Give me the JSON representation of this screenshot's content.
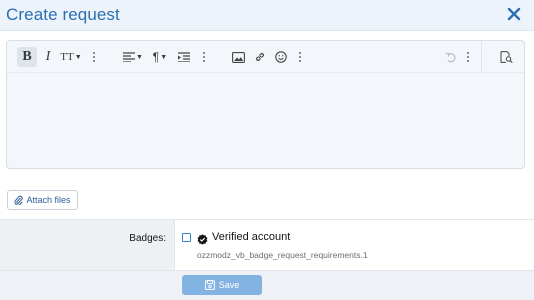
{
  "header": {
    "title": "Create request",
    "close_icon": "close-icon"
  },
  "editor": {
    "toolbar": {
      "bold": "B",
      "italic": "I",
      "font_size": "TT",
      "icons": [
        "bold-icon",
        "italic-icon",
        "font-size-icon",
        "more-icon",
        "align-icon",
        "paragraph-icon",
        "indent-icon",
        "more-icon",
        "image-icon",
        "link-icon",
        "emoji-icon",
        "more-icon",
        "undo-icon",
        "more-icon",
        "preview-icon"
      ]
    },
    "content": ""
  },
  "attach": {
    "label": "Attach files"
  },
  "form": {
    "badges_label": "Badges:",
    "badge_option": "Verified account",
    "badge_hint": "ozzmodz_vb_badge_request_requirements.1",
    "checked": false
  },
  "footer": {
    "save_label": "Save"
  },
  "colors": {
    "accent": "#2c6fb2",
    "save_bg": "#82b3e3",
    "header_bg": "#edf3fa"
  }
}
